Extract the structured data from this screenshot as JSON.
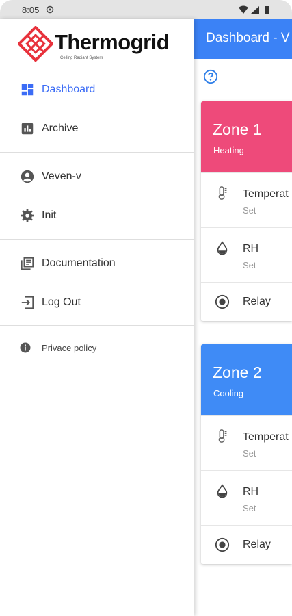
{
  "status_bar": {
    "time": "8:05"
  },
  "app": {
    "title": "Dashboard - V",
    "zones": [
      {
        "title": "Zone 1",
        "mode": "Heating",
        "color": "#ee4a7a",
        "rows": [
          {
            "icon": "thermometer-icon",
            "label": "Temperat",
            "sub": "Set"
          },
          {
            "icon": "water-drop-icon",
            "label": "RH",
            "sub": "Set"
          },
          {
            "icon": "radio-button-icon",
            "label": "Relay",
            "sub": ""
          }
        ]
      },
      {
        "title": "Zone 2",
        "mode": "Cooling",
        "color": "#3f8bf6",
        "rows": [
          {
            "icon": "thermometer-icon",
            "label": "Temperat",
            "sub": "Set"
          },
          {
            "icon": "water-drop-icon",
            "label": "RH",
            "sub": "Set"
          },
          {
            "icon": "radio-button-icon",
            "label": "Relay",
            "sub": ""
          }
        ]
      }
    ]
  },
  "drawer": {
    "logo_text": "Thermogrid",
    "logo_tagline": "Ceiling Radiant System",
    "brand_color": "#e8323c",
    "accent_color": "#3b6cf6",
    "nav": {
      "dashboard": "Dashboard",
      "archive": "Archive",
      "user": "Veven-v",
      "init": "Init",
      "documentation": "Documentation",
      "logout": "Log Out",
      "privacy": "Privace policy"
    }
  }
}
